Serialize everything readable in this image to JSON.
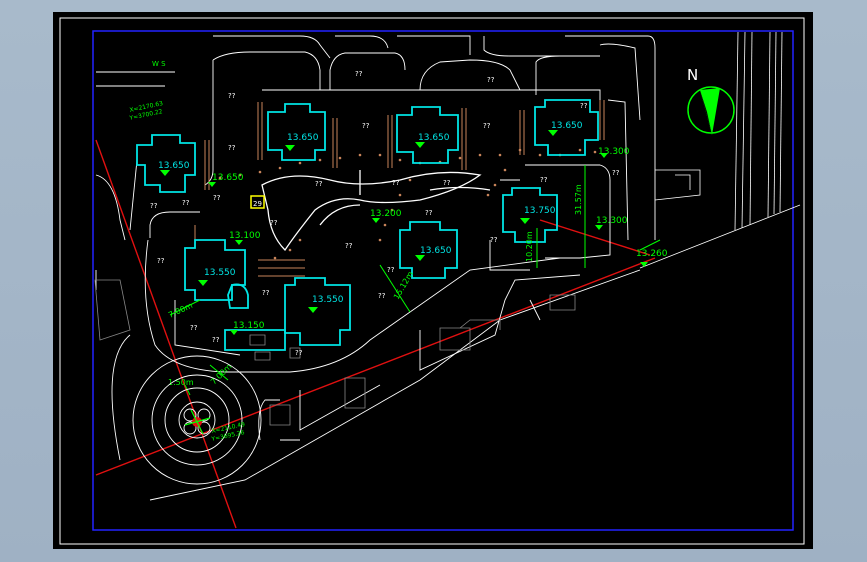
{
  "drawing": {
    "north_label": "N",
    "elevations": [
      "13.650",
      "13.650",
      "13.650",
      "13.650",
      "13.650",
      "13.750",
      "13.550",
      "13.550",
      "13.150",
      "13.200",
      "13.100",
      "13.300",
      "13.260"
    ],
    "unknown_label": "??",
    "dimensions": [
      "10.20m",
      "31.57m",
      "15.12m",
      "7.00m",
      "1.50m",
      "7.00m"
    ],
    "coords": [
      "X=2170.63",
      "Y=3700.22",
      "X=2110.49",
      "Y=3695.26"
    ],
    "marker_label": "29",
    "top_left_text": "W S"
  },
  "colors": {
    "background": "#000000",
    "frame": "#1a1aff",
    "building": "#00e5e5",
    "label": "#00ff00",
    "road": "#ffffff",
    "axis": "#e01010",
    "paving": "#c8845a"
  }
}
